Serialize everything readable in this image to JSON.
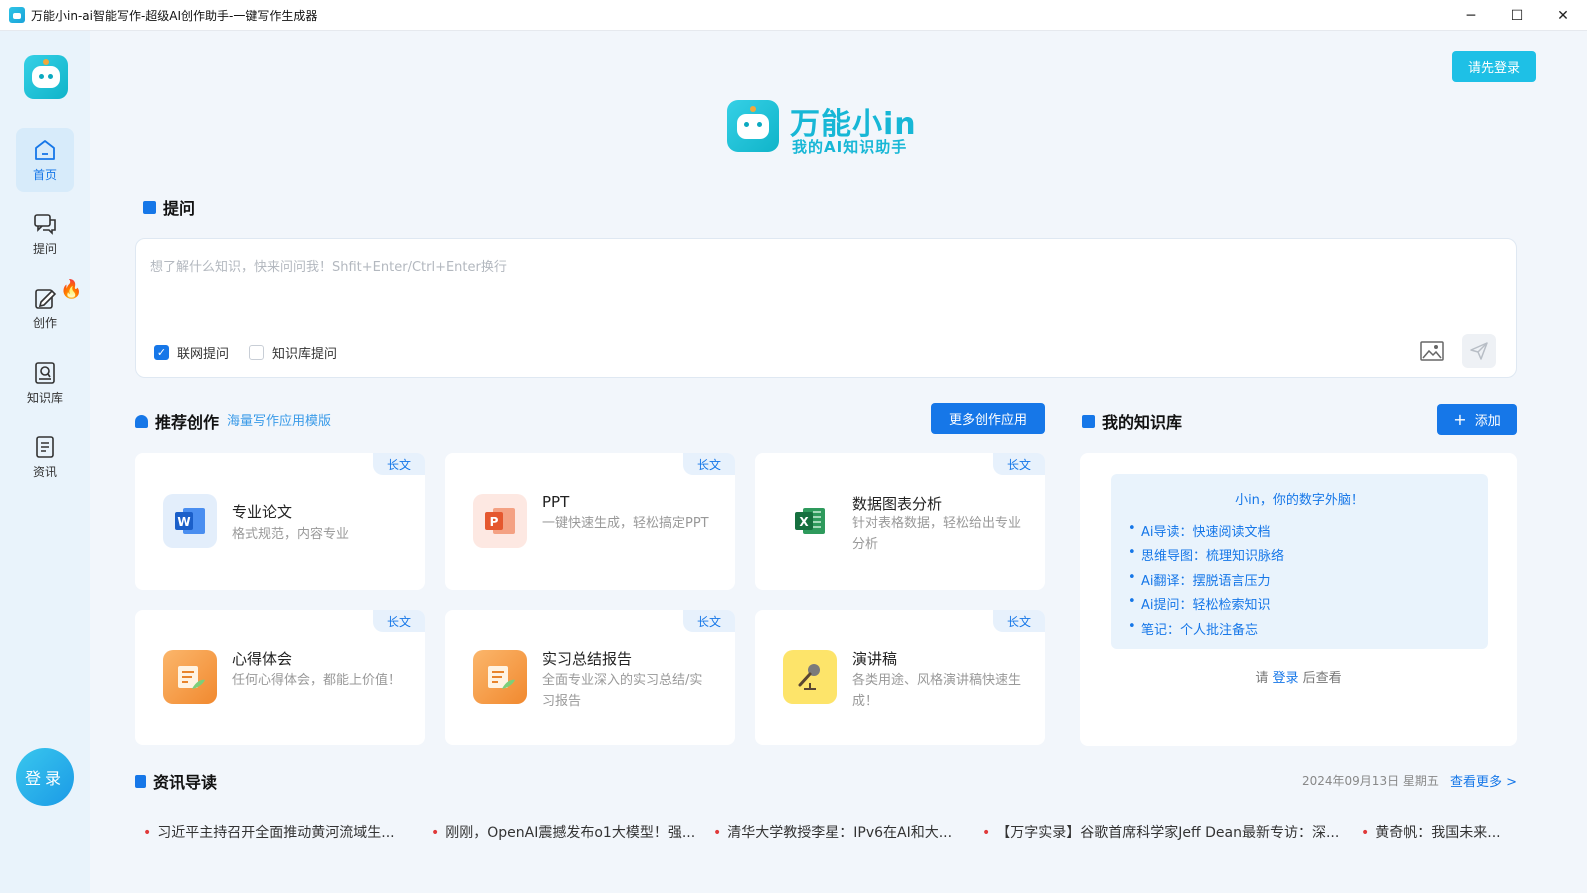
{
  "window": {
    "title": "万能小in-ai智能写作-超级AI创作助手-一键写作生成器",
    "min_glyph": "─",
    "max_glyph": "☐",
    "close_glyph": "✕"
  },
  "sidebar": {
    "items": [
      {
        "label": "首页",
        "icon": "home-icon",
        "active": true
      },
      {
        "label": "提问",
        "icon": "chat-icon"
      },
      {
        "label": "创作",
        "icon": "edit-icon",
        "badge": "fire-icon"
      },
      {
        "label": "知识库",
        "icon": "knowledge-icon"
      },
      {
        "label": "资讯",
        "icon": "news-icon"
      }
    ],
    "login_label": "登录"
  },
  "header": {
    "login_button": "请先登录",
    "brand_name": "万能小in",
    "brand_sub": "我的AI知识助手"
  },
  "ask": {
    "section_title": "提问",
    "placeholder": "想了解什么知识，快来问问我！Shfit+Enter/Ctrl+Enter换行",
    "option_web": {
      "label": "联网提问",
      "checked": true
    },
    "option_kb": {
      "label": "知识库提问",
      "checked": false
    }
  },
  "recommend": {
    "section_title": "推荐创作",
    "sub_link": "海量写作应用模版",
    "more_button": "更多创作应用",
    "cards": [
      {
        "title": "专业论文",
        "desc": "格式规范，内容专业",
        "tag": "长文",
        "icon": "word-icon"
      },
      {
        "title": "PPT",
        "desc": "一键快速生成，轻松搞定PPT",
        "tag": "长文",
        "icon": "ppt-icon"
      },
      {
        "title": "数据图表分析",
        "desc": "针对表格数据，轻松给出专业分析",
        "tag": "长文",
        "icon": "excel-icon"
      },
      {
        "title": "心得体会",
        "desc": "任何心得体会，都能上价值！",
        "tag": "长文",
        "icon": "notes-icon"
      },
      {
        "title": "实习总结报告",
        "desc": "全面专业深入的实习总结/实习报告",
        "tag": "长文",
        "icon": "report-icon"
      },
      {
        "title": "演讲稿",
        "desc": "各类用途、风格演讲稿快速生成！",
        "tag": "长文",
        "icon": "microphone-icon"
      }
    ]
  },
  "knowledge": {
    "section_title": "我的知识库",
    "add_button": "添加",
    "intro_title": "小in，你的数字外脑！",
    "features": [
      "Ai导读：快速阅读文档",
      "思维导图：梳理知识脉络",
      "Ai翻译：摆脱语言压力",
      "Ai提问：轻松检索知识",
      "笔记：个人批注备忘"
    ],
    "login_prefix": "请",
    "login_link": "登录",
    "login_suffix": "后查看"
  },
  "news": {
    "section_title": "资讯导读",
    "date": "2024年09月13日 星期五",
    "more_link": "查看更多 >",
    "items": [
      "习近平主持召开全面推动黄河流域生...",
      "刚刚，OpenAI震撼发布o1大模型！强...",
      "清华大学教授李星：IPv6在AI和大...",
      "【万字实录】谷歌首席科学家Jeff Dean最新专访：深...",
      "黄奇帆：我国未来..."
    ]
  },
  "colors": {
    "accent": "#1677e8",
    "brand": "#17b7d6",
    "sidebar_bg": "#e9f3fb",
    "page_bg": "#f2f6fb"
  }
}
